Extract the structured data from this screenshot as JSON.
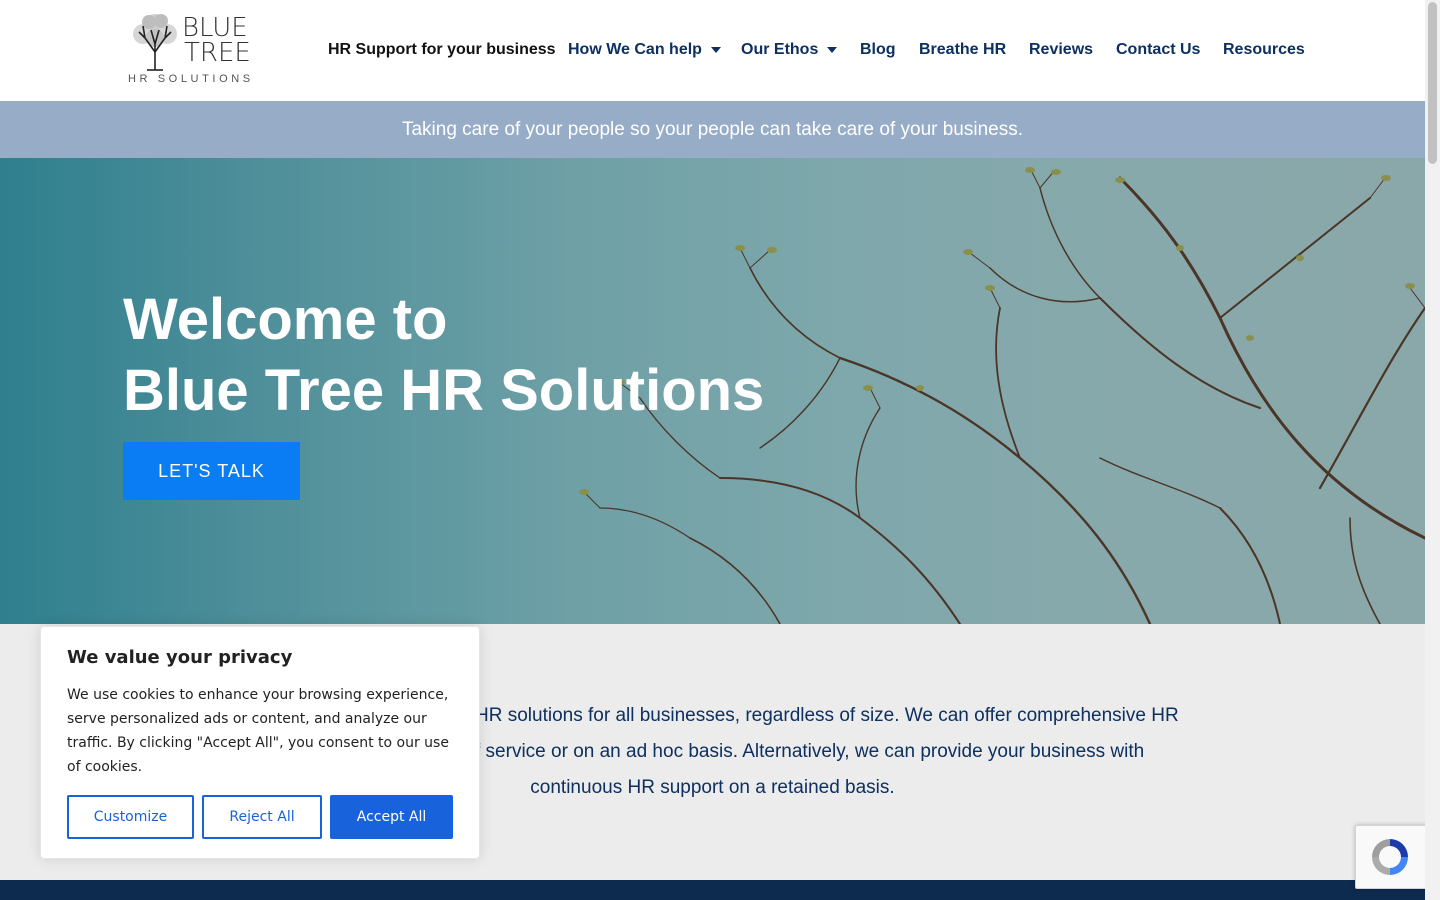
{
  "brand": {
    "logo_line1": "BLUE",
    "logo_line2": "TREE",
    "logo_sub": "HR SOLUTIONS"
  },
  "nav": {
    "items": [
      {
        "label": "HR Support for your business"
      },
      {
        "label": "How We Can help"
      },
      {
        "label": "Our Ethos"
      },
      {
        "label": "Blog"
      },
      {
        "label": "Breathe HR"
      },
      {
        "label": "Reviews"
      },
      {
        "label": "Contact Us"
      },
      {
        "label": "Resources"
      }
    ]
  },
  "tagline": "Taking care of your people so your people can take care of your business.",
  "hero": {
    "title_line1": "Welcome to",
    "title_line2": "Blue Tree HR Solutions",
    "cta_label": "LET'S TALK"
  },
  "intro": {
    "line1": "HR solutions for all businesses, regardless of size. We can offer comprehensive HR",
    "line2": "f service or on an ad hoc basis. Alternatively, we can provide your business with",
    "line3": "continuous HR support on a retained basis."
  },
  "cookie": {
    "title": "We value your privacy",
    "body": "We use cookies to enhance your browsing experience, serve personalized ads or content, and analyze our traffic. By clicking \"Accept All\", you consent to our use of cookies.",
    "customize_label": "Customize",
    "reject_label": "Reject All",
    "accept_label": "Accept All"
  },
  "colors": {
    "nav_text": "#0d3060",
    "tagline_bg": "#97acc6",
    "cta_bg": "#0a7cf4",
    "cookie_accent": "#1863dc",
    "footer_band": "#0d2a4f"
  },
  "icons": {
    "logo": "tree-logo-icon",
    "dropdown": "caret-down-icon",
    "recaptcha": "recaptcha-icon"
  }
}
